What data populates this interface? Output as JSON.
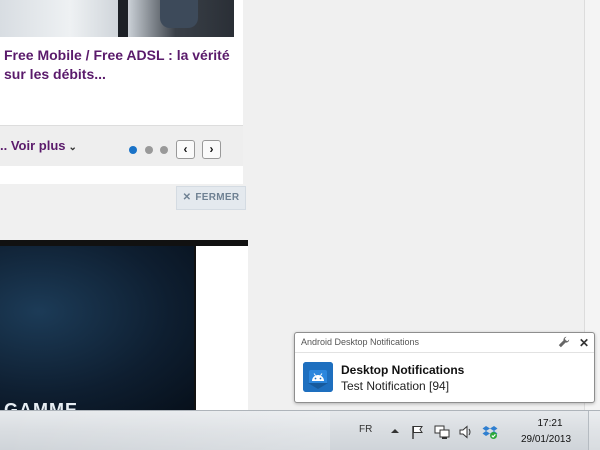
{
  "article": {
    "title": "Free Mobile / Free ADSL : la vérité sur les débits..."
  },
  "carousel": {
    "voir_plus": ".. Voir plus",
    "prev_icon": "chevron-left-icon",
    "next_icon": "chevron-right-icon",
    "active_dot": 0,
    "dot_count": 3
  },
  "fermer": {
    "label": "FERMER",
    "icon": "close-icon"
  },
  "banner": {
    "text": "GAMME"
  },
  "notification": {
    "app_name": "Android Desktop Notifications",
    "title": "Desktop Notifications",
    "body": "Test Notification [94]",
    "icon": "android-icon",
    "accent": "#1e6fbf"
  },
  "taskbar": {
    "language": "FR",
    "time": "17:21",
    "date": "29/01/2013",
    "tray_icons": [
      "show-hidden-icon",
      "action-center-flag-icon",
      "network-icon",
      "volume-icon",
      "dropbox-icon"
    ]
  },
  "colors": {
    "link_purple": "#5a1a6b",
    "dot_active": "#1a73c8",
    "dot_inactive": "#999999"
  }
}
